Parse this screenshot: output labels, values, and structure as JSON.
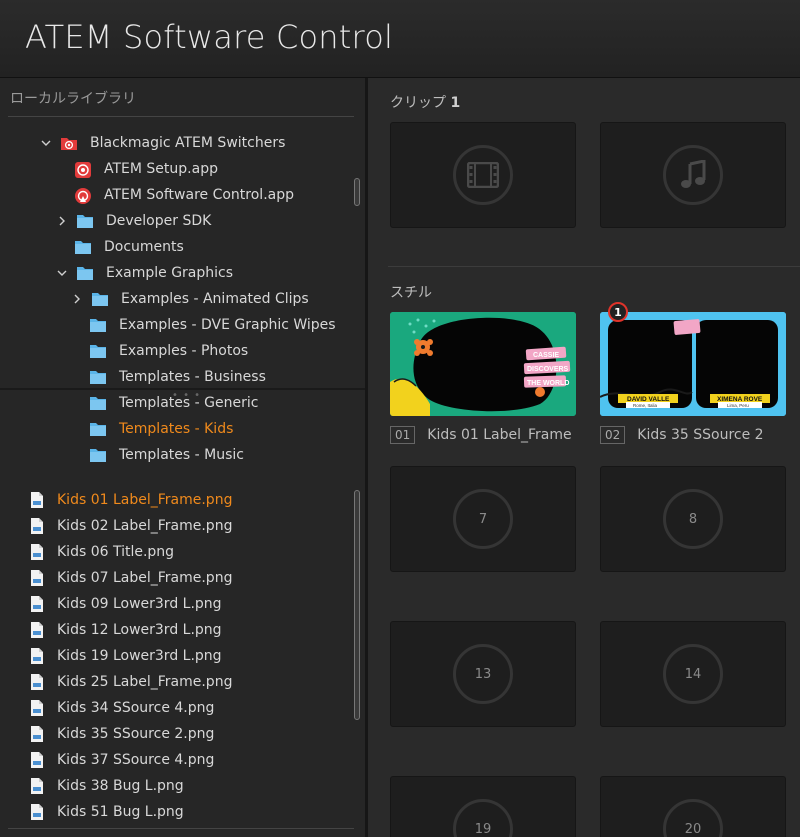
{
  "app": {
    "title": "ATEM Software Control"
  },
  "library": {
    "header": "ローカルライブラリ",
    "tree": [
      {
        "label": "Blackmagic ATEM Switchers",
        "icon": "atem-folder-icon",
        "expanded": true
      },
      {
        "label": "ATEM Setup.app",
        "icon": "atem-setup-app-icon"
      },
      {
        "label": "ATEM Software Control.app",
        "icon": "atem-control-app-icon"
      },
      {
        "label": "Developer SDK",
        "icon": "folder-icon",
        "expanded": false
      },
      {
        "label": "Documents",
        "icon": "folder-icon"
      },
      {
        "label": "Example Graphics",
        "icon": "folder-icon",
        "expanded": true
      },
      {
        "label": "Examples - Animated Clips",
        "icon": "folder-icon",
        "expanded": false
      },
      {
        "label": "Examples - DVE Graphic Wipes",
        "icon": "folder-icon"
      },
      {
        "label": "Examples - Photos",
        "icon": "folder-icon"
      },
      {
        "label": "Templates - Business",
        "icon": "folder-icon"
      },
      {
        "label": "Templates - Generic",
        "icon": "folder-icon"
      },
      {
        "label": "Templates - Kids",
        "icon": "folder-icon",
        "selected": true
      },
      {
        "label": "Templates - Music",
        "icon": "folder-icon"
      }
    ],
    "split_handle": "• • •",
    "files": [
      {
        "label": "Kids 01 Label_Frame.png",
        "selected": true
      },
      {
        "label": "Kids 02 Label_Frame.png"
      },
      {
        "label": "Kids 06 Title.png"
      },
      {
        "label": "Kids 07 Label_Frame.png"
      },
      {
        "label": "Kids 09 Lower3rd L.png"
      },
      {
        "label": "Kids 12 Lower3rd L.png"
      },
      {
        "label": "Kids 19 Lower3rd L.png"
      },
      {
        "label": "Kids 25 Label_Frame.png"
      },
      {
        "label": "Kids 34 SSource 4.png"
      },
      {
        "label": "Kids 35 SSource 2.png"
      },
      {
        "label": "Kids 37 SSource 4.png"
      },
      {
        "label": "Kids 38 Bug L.png"
      },
      {
        "label": "Kids 51 Bug L.png"
      }
    ]
  },
  "media": {
    "clip_section": {
      "label": "クリップ",
      "number": "1"
    },
    "clip_slots": [
      {
        "icon": "film-icon"
      },
      {
        "icon": "music-note-icon"
      }
    ],
    "stills_section": {
      "label": "スチル"
    },
    "stills": [
      {
        "number": "01",
        "name": "Kids 01 Label_Frame",
        "thumb_text": [
          "CASSIE",
          "DISCOVERS",
          "THE WORLD"
        ],
        "colors": {
          "bg": "#1aa87e",
          "accent": "#f2d21d",
          "tag": "#f2a6c6"
        }
      },
      {
        "number": "02",
        "name": "Kids 35 SSource 2",
        "badge": "1",
        "thumb_text": [
          "DAVID VALLE",
          "Rome, Italia",
          "XIMENA ROVE",
          "Lima, Peru"
        ],
        "colors": {
          "bg": "#4fc3f0",
          "accent": "#f2d21d"
        }
      }
    ],
    "empty_slots": [
      "7",
      "8",
      "13",
      "14",
      "19",
      "20"
    ]
  },
  "colors": {
    "selected": "#f08a1c",
    "folder": "#5ab4e8"
  }
}
